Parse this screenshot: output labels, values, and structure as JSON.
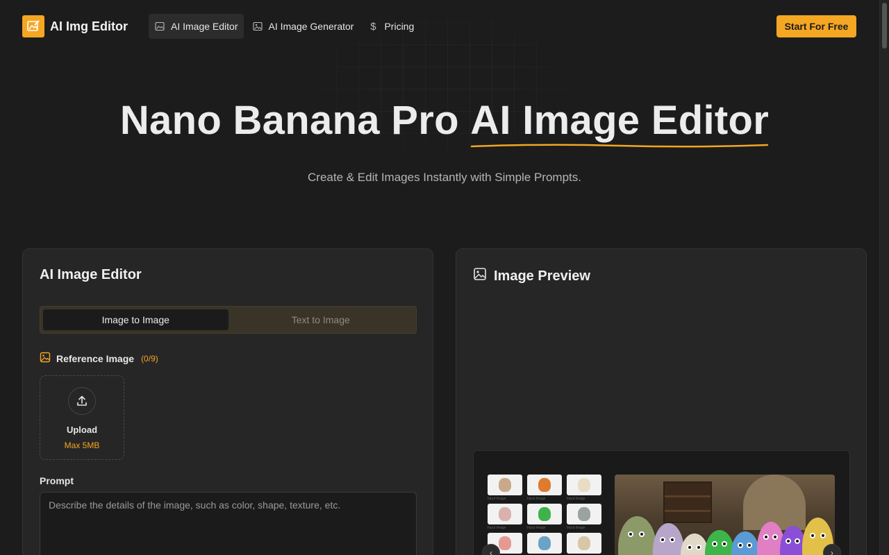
{
  "brand": {
    "name": "AI Img Editor",
    "accent": "#f5a623"
  },
  "nav": {
    "items": [
      {
        "label": "AI Image Editor",
        "icon": "image-edit-icon",
        "active": true
      },
      {
        "label": "AI Image Generator",
        "icon": "image-icon",
        "active": false
      },
      {
        "label": "Pricing",
        "icon": "dollar-icon",
        "active": false
      }
    ],
    "cta": "Start For Free"
  },
  "hero": {
    "title_main": "Nano Banana Pro ",
    "title_accent": "AI Image Editor",
    "subtitle": "Create & Edit Images Instantly with Simple Prompts."
  },
  "editor": {
    "title": "AI Image Editor",
    "tabs": [
      {
        "label": "Image to Image",
        "active": true
      },
      {
        "label": "Text to Image",
        "active": false
      }
    ],
    "reference": {
      "label": "Reference Image",
      "count": "(0/9)"
    },
    "upload": {
      "label": "Upload",
      "max": "Max 5MB"
    },
    "prompt": {
      "label": "Prompt",
      "placeholder": "Describe the details of the image, such as color, shape, texture, etc."
    }
  },
  "preview": {
    "title": "Image Preview",
    "thumb_caption": "Input Image",
    "thumb_colors": [
      "#c9a98a",
      "#e07a2c",
      "#e8dcc4",
      "#d9b2b0",
      "#3fb34b",
      "#9aa3a0",
      "#e49a92",
      "#6aa3c6",
      "#d8c7a6"
    ]
  }
}
